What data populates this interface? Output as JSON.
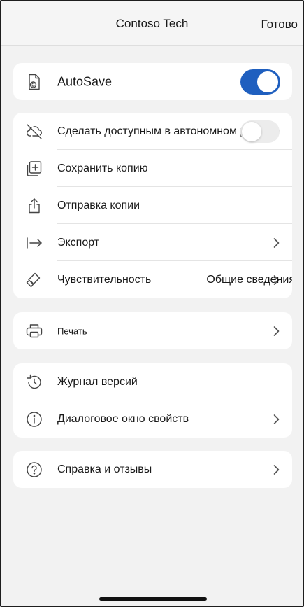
{
  "header": {
    "title": "Contoso Tech",
    "done_label": "Готово"
  },
  "autosave": {
    "label": "AutoSave",
    "icon": "autosave-document-icon",
    "enabled": true,
    "accent": "#1f5fbf"
  },
  "file_actions": [
    {
      "label": "Сделать доступным в автономном режиме",
      "icon": "cloud-off-icon",
      "toggle": false
    },
    {
      "label": "Сохранить копию",
      "icon": "save-copy-icon"
    },
    {
      "label": "Отправка копии",
      "icon": "share-icon"
    },
    {
      "label": "Экспорт",
      "icon": "export-icon",
      "chevron": true
    },
    {
      "label": "Чувствительность",
      "icon": "sensitivity-icon",
      "value": "Общие сведения",
      "chevron": true
    }
  ],
  "print": {
    "label": "Печать",
    "icon": "printer-icon"
  },
  "info": [
    {
      "label": "Журнал версий",
      "icon": "history-icon"
    },
    {
      "label": "Диалоговое окно свойств",
      "icon": "info-icon"
    }
  ],
  "help": {
    "label": "Справка и отзывы",
    "icon": "help-icon"
  }
}
